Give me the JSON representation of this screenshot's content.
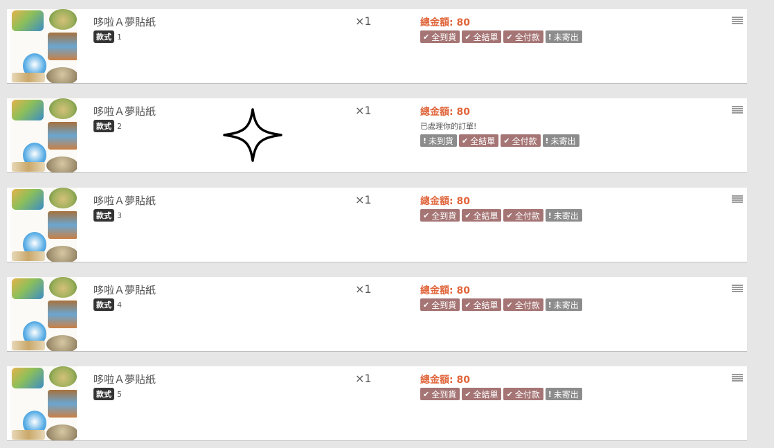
{
  "orders": [
    {
      "product": "哆啦Ａ夢貼紙",
      "variant_tag": "款式",
      "variant_value": "1",
      "qty": "×1",
      "total": "總金額: 80",
      "message": "",
      "badges": [
        {
          "icon": "check-icon",
          "label": "全到貨",
          "state": "ok"
        },
        {
          "icon": "check-icon",
          "label": "全結單",
          "state": "ok"
        },
        {
          "icon": "check-icon",
          "label": "全付款",
          "state": "ok"
        },
        {
          "icon": "exclamation-icon",
          "label": "未寄出",
          "state": "no"
        }
      ]
    },
    {
      "product": "哆啦Ａ夢貼紙",
      "variant_tag": "款式",
      "variant_value": "2",
      "qty": "×1",
      "total": "總金額: 80",
      "message": "已處理你的訂單!",
      "badges": [
        {
          "icon": "exclamation-icon",
          "label": "未到貨",
          "state": "no"
        },
        {
          "icon": "check-icon",
          "label": "全結單",
          "state": "ok"
        },
        {
          "icon": "check-icon",
          "label": "全付款",
          "state": "ok"
        },
        {
          "icon": "exclamation-icon",
          "label": "未寄出",
          "state": "no"
        }
      ]
    },
    {
      "product": "哆啦Ａ夢貼紙",
      "variant_tag": "款式",
      "variant_value": "3",
      "qty": "×1",
      "total": "總金額: 80",
      "message": "",
      "badges": [
        {
          "icon": "check-icon",
          "label": "全到貨",
          "state": "ok"
        },
        {
          "icon": "check-icon",
          "label": "全結單",
          "state": "ok"
        },
        {
          "icon": "check-icon",
          "label": "全付款",
          "state": "ok"
        },
        {
          "icon": "exclamation-icon",
          "label": "未寄出",
          "state": "no"
        }
      ]
    },
    {
      "product": "哆啦Ａ夢貼紙",
      "variant_tag": "款式",
      "variant_value": "4",
      "qty": "×1",
      "total": "總金額: 80",
      "message": "",
      "badges": [
        {
          "icon": "check-icon",
          "label": "全到貨",
          "state": "ok"
        },
        {
          "icon": "check-icon",
          "label": "全結單",
          "state": "ok"
        },
        {
          "icon": "check-icon",
          "label": "全付款",
          "state": "ok"
        },
        {
          "icon": "exclamation-icon",
          "label": "未寄出",
          "state": "no"
        }
      ]
    },
    {
      "product": "哆啦Ａ夢貼紙",
      "variant_tag": "款式",
      "variant_value": "5",
      "qty": "×1",
      "total": "總金額: 80",
      "message": "",
      "badges": [
        {
          "icon": "check-icon",
          "label": "全到貨",
          "state": "ok"
        },
        {
          "icon": "check-icon",
          "label": "全結單",
          "state": "ok"
        },
        {
          "icon": "check-icon",
          "label": "全付款",
          "state": "ok"
        },
        {
          "icon": "exclamation-icon",
          "label": "未寄出",
          "state": "no"
        }
      ]
    }
  ],
  "colors": {
    "total_accent": "#e0663c",
    "badge_ok": "#a57474",
    "badge_pending": "#8c8c8c"
  },
  "cursor_icon": "four-point-star-icon"
}
